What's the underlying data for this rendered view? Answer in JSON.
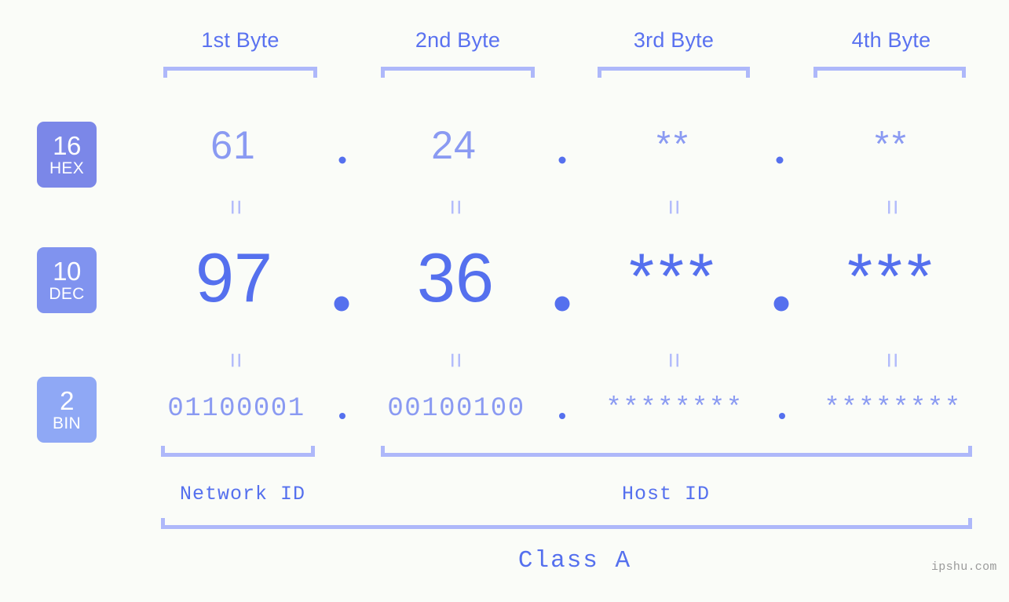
{
  "page": {
    "background_color": "#fafcf8",
    "accent_color": "#5570ee",
    "accent_light_color": "#8a9af2",
    "bracket_color": "#aeb8fa"
  },
  "byte_headers": [
    {
      "label": "1st Byte"
    },
    {
      "label": "2nd Byte"
    },
    {
      "label": "3rd Byte"
    },
    {
      "label": "4th Byte"
    }
  ],
  "radix_rows": [
    {
      "badge_number": "16",
      "badge_name": "HEX",
      "badge_color": "#7b87e8",
      "values": [
        "61",
        "24",
        "**",
        "**"
      ]
    },
    {
      "badge_number": "10",
      "badge_name": "DEC",
      "badge_color": "#8093ef",
      "values": [
        "97",
        "36",
        "***",
        "***"
      ]
    },
    {
      "badge_number": "2",
      "badge_name": "BIN",
      "badge_color": "#8fa8f5",
      "values": [
        "01100001",
        "00100100",
        "********",
        "********"
      ]
    }
  ],
  "separators": {
    "dot": ".",
    "equals": "="
  },
  "segments": {
    "network_id_label": "Network ID",
    "host_id_label": "Host ID",
    "class_label": "Class A"
  },
  "watermark": {
    "text": "ipshu.com"
  }
}
